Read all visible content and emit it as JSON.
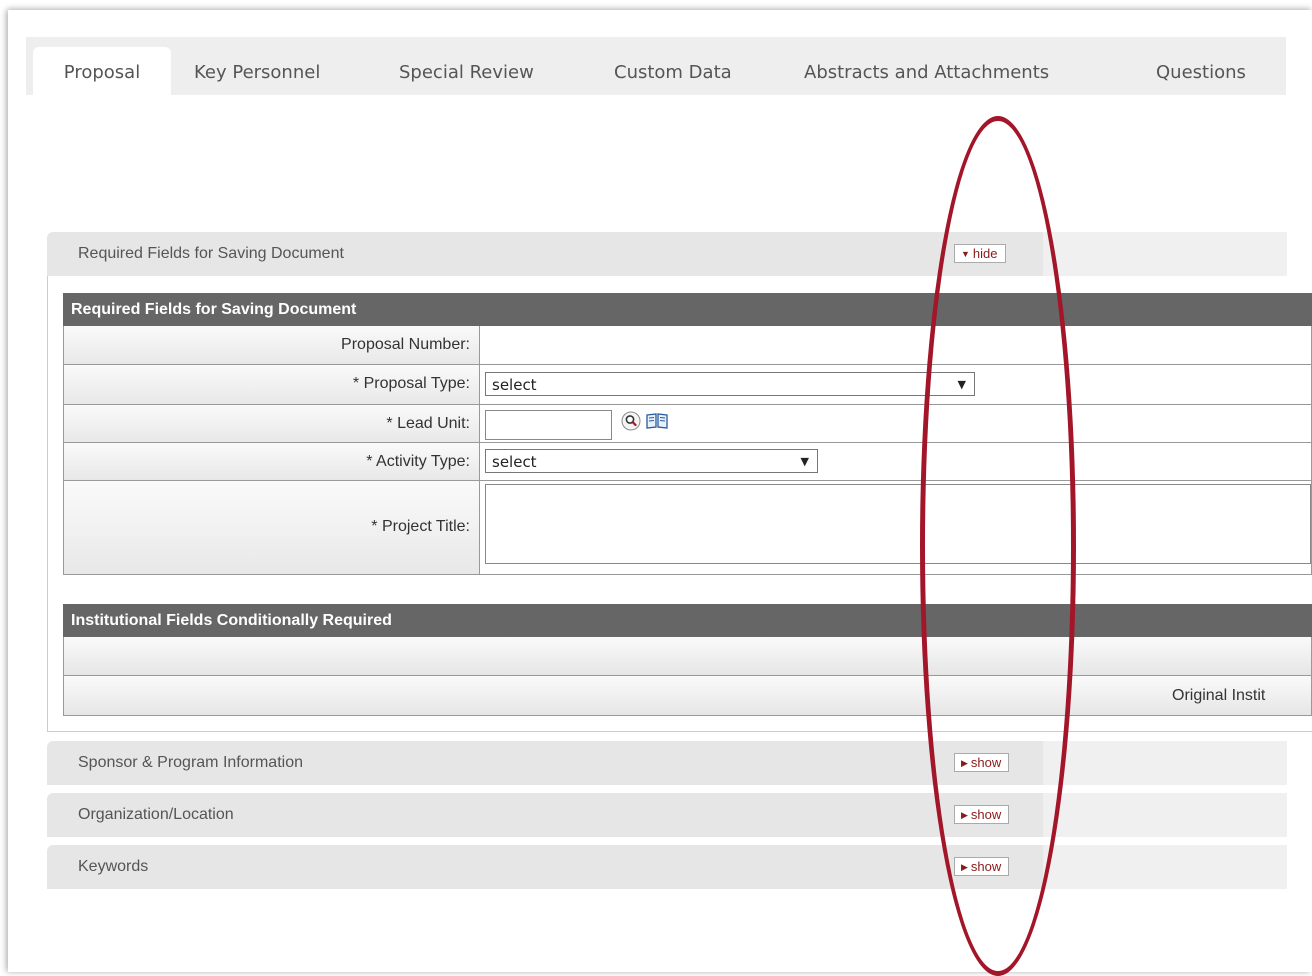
{
  "tabs": [
    "Proposal",
    "Key Personnel",
    "Special Review",
    "Custom Data",
    "Abstracts and Attachments",
    "Questions"
  ],
  "sections": {
    "required": {
      "title": "Required Fields for Saving Document",
      "toggle": "hide"
    },
    "sponsor": {
      "title": "Sponsor & Program Information",
      "toggle": "show"
    },
    "organization": {
      "title": "Organization/Location",
      "toggle": "show"
    },
    "keywords": {
      "title": "Keywords",
      "toggle": "show"
    }
  },
  "required_table": {
    "header": "Required Fields for Saving Document",
    "proposal_number_label": "Proposal Number:",
    "proposal_type_label": "*  Proposal Type:",
    "proposal_type_value": "select",
    "lead_unit_label": "*  Lead Unit:",
    "lead_unit_value": "",
    "activity_type_label": "*  Activity Type:",
    "activity_type_value": "select",
    "project_title_label": "*  Project Title:",
    "project_title_value": ""
  },
  "institutional": {
    "header": "Institutional Fields Conditionally Required",
    "original_label": "Original Instit"
  },
  "icons": {
    "arrow_down": "▼",
    "arrow_right": "▶",
    "lookup": "magnifier-icon",
    "book": "book-icon"
  },
  "annotation": {
    "color": "#a3162a"
  }
}
